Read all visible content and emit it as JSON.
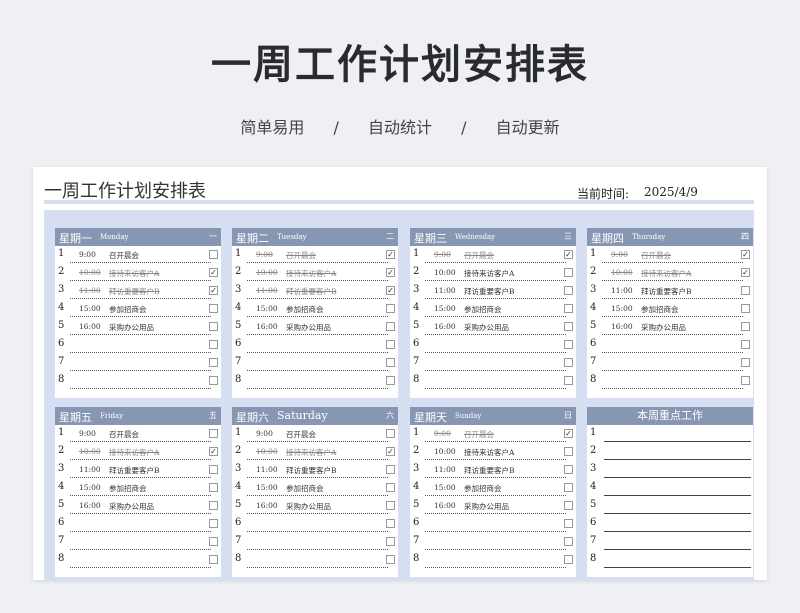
{
  "hero": {
    "title": "一周工作计划安排表",
    "subtitle": [
      "简单易用",
      "/",
      "自动统计",
      "/",
      "自动更新"
    ]
  },
  "sheet": {
    "title": "一周工作计划安排表",
    "date_label": "当前时间:",
    "date_value": "2025/4/9"
  },
  "days": [
    {
      "name": "星期一",
      "en": "Monday",
      "ch": "一",
      "rows": [
        {
          "no": "1",
          "time": "9:00",
          "task": "召开晨会",
          "done": false
        },
        {
          "no": "2",
          "time": "10:00",
          "task": "接待来访客户A",
          "done": true
        },
        {
          "no": "3",
          "time": "11:00",
          "task": "拜访重要客户B",
          "done": true
        },
        {
          "no": "4",
          "time": "15:00",
          "task": "参加招商会",
          "done": false
        },
        {
          "no": "5",
          "time": "16:00",
          "task": "采购办公用品",
          "done": false
        },
        {
          "no": "6",
          "time": "",
          "task": "",
          "done": false
        },
        {
          "no": "7",
          "time": "",
          "task": "",
          "done": false
        },
        {
          "no": "8",
          "time": "",
          "task": "",
          "done": false
        }
      ]
    },
    {
      "name": "星期二",
      "en": "Tuesday",
      "ch": "二",
      "rows": [
        {
          "no": "1",
          "time": "9:00",
          "task": "召开晨会",
          "done": true
        },
        {
          "no": "2",
          "time": "10:00",
          "task": "接待来访客户A",
          "done": true
        },
        {
          "no": "3",
          "time": "11:00",
          "task": "拜访重要客户B",
          "done": true
        },
        {
          "no": "4",
          "time": "15:00",
          "task": "参加招商会",
          "done": false
        },
        {
          "no": "5",
          "time": "16:00",
          "task": "采购办公用品",
          "done": false
        },
        {
          "no": "6",
          "time": "",
          "task": "",
          "done": false
        },
        {
          "no": "7",
          "time": "",
          "task": "",
          "done": false
        },
        {
          "no": "8",
          "time": "",
          "task": "",
          "done": false
        }
      ]
    },
    {
      "name": "星期三",
      "en": "Wednesday",
      "ch": "三",
      "rows": [
        {
          "no": "1",
          "time": "9:00",
          "task": "召开晨会",
          "done": true
        },
        {
          "no": "2",
          "time": "10:00",
          "task": "接待来访客户A",
          "done": false
        },
        {
          "no": "3",
          "time": "11:00",
          "task": "拜访重要客户B",
          "done": false
        },
        {
          "no": "4",
          "time": "15:00",
          "task": "参加招商会",
          "done": false
        },
        {
          "no": "5",
          "time": "16:00",
          "task": "采购办公用品",
          "done": false
        },
        {
          "no": "6",
          "time": "",
          "task": "",
          "done": false
        },
        {
          "no": "7",
          "time": "",
          "task": "",
          "done": false
        },
        {
          "no": "8",
          "time": "",
          "task": "",
          "done": false
        }
      ]
    },
    {
      "name": "星期四",
      "en": "Thursday",
      "ch": "四",
      "rows": [
        {
          "no": "1",
          "time": "9:00",
          "task": "召开晨会",
          "done": true
        },
        {
          "no": "2",
          "time": "10:00",
          "task": "接待来访客户A",
          "done": true
        },
        {
          "no": "3",
          "time": "11:00",
          "task": "拜访重要客户B",
          "done": false
        },
        {
          "no": "4",
          "time": "15:00",
          "task": "参加招商会",
          "done": false
        },
        {
          "no": "5",
          "time": "16:00",
          "task": "采购办公用品",
          "done": false
        },
        {
          "no": "6",
          "time": "",
          "task": "",
          "done": false
        },
        {
          "no": "7",
          "time": "",
          "task": "",
          "done": false
        },
        {
          "no": "8",
          "time": "",
          "task": "",
          "done": false
        }
      ]
    },
    {
      "name": "星期五",
      "en": "Friday",
      "ch": "五",
      "rows": [
        {
          "no": "1",
          "time": "9:00",
          "task": "召开晨会",
          "done": false
        },
        {
          "no": "2",
          "time": "10:00",
          "task": "接待来访客户A",
          "done": true
        },
        {
          "no": "3",
          "time": "11:00",
          "task": "拜访重要客户B",
          "done": false
        },
        {
          "no": "4",
          "time": "15:00",
          "task": "参加招商会",
          "done": false
        },
        {
          "no": "5",
          "time": "16:00",
          "task": "采购办公用品",
          "done": false
        },
        {
          "no": "6",
          "time": "",
          "task": "",
          "done": false
        },
        {
          "no": "7",
          "time": "",
          "task": "",
          "done": false
        },
        {
          "no": "8",
          "time": "",
          "task": "",
          "done": false
        }
      ]
    },
    {
      "name": "星期六",
      "en": "Saturday",
      "ch": "六",
      "rows": [
        {
          "no": "1",
          "time": "9:00",
          "task": "召开晨会",
          "done": false
        },
        {
          "no": "2",
          "time": "10:00",
          "task": "接待来访客户A",
          "done": true
        },
        {
          "no": "3",
          "time": "11:00",
          "task": "拜访重要客户B",
          "done": false
        },
        {
          "no": "4",
          "time": "15:00",
          "task": "参加招商会",
          "done": false
        },
        {
          "no": "5",
          "time": "16:00",
          "task": "采购办公用品",
          "done": false
        },
        {
          "no": "6",
          "time": "",
          "task": "",
          "done": false
        },
        {
          "no": "7",
          "time": "",
          "task": "",
          "done": false
        },
        {
          "no": "8",
          "time": "",
          "task": "",
          "done": false
        }
      ]
    },
    {
      "name": "星期天",
      "en": "Sunday",
      "ch": "日",
      "rows": [
        {
          "no": "1",
          "time": "9:00",
          "task": "召开晨会",
          "done": true
        },
        {
          "no": "2",
          "time": "10:00",
          "task": "接待来访客户A",
          "done": false
        },
        {
          "no": "3",
          "time": "11:00",
          "task": "拜访重要客户B",
          "done": false
        },
        {
          "no": "4",
          "time": "15:00",
          "task": "参加招商会",
          "done": false
        },
        {
          "no": "5",
          "time": "16:00",
          "task": "采购办公用品",
          "done": false
        },
        {
          "no": "6",
          "time": "",
          "task": "",
          "done": false
        },
        {
          "no": "7",
          "time": "",
          "task": "",
          "done": false
        },
        {
          "no": "8",
          "time": "",
          "task": "",
          "done": false
        }
      ]
    }
  ],
  "focus": {
    "title": "本周重点工作",
    "numbers": [
      "1",
      "2",
      "3",
      "4",
      "5",
      "6",
      "7",
      "8"
    ]
  },
  "colors": {
    "header": "#8797b3",
    "band": "#d6dff1",
    "background": "#eef0f4"
  }
}
